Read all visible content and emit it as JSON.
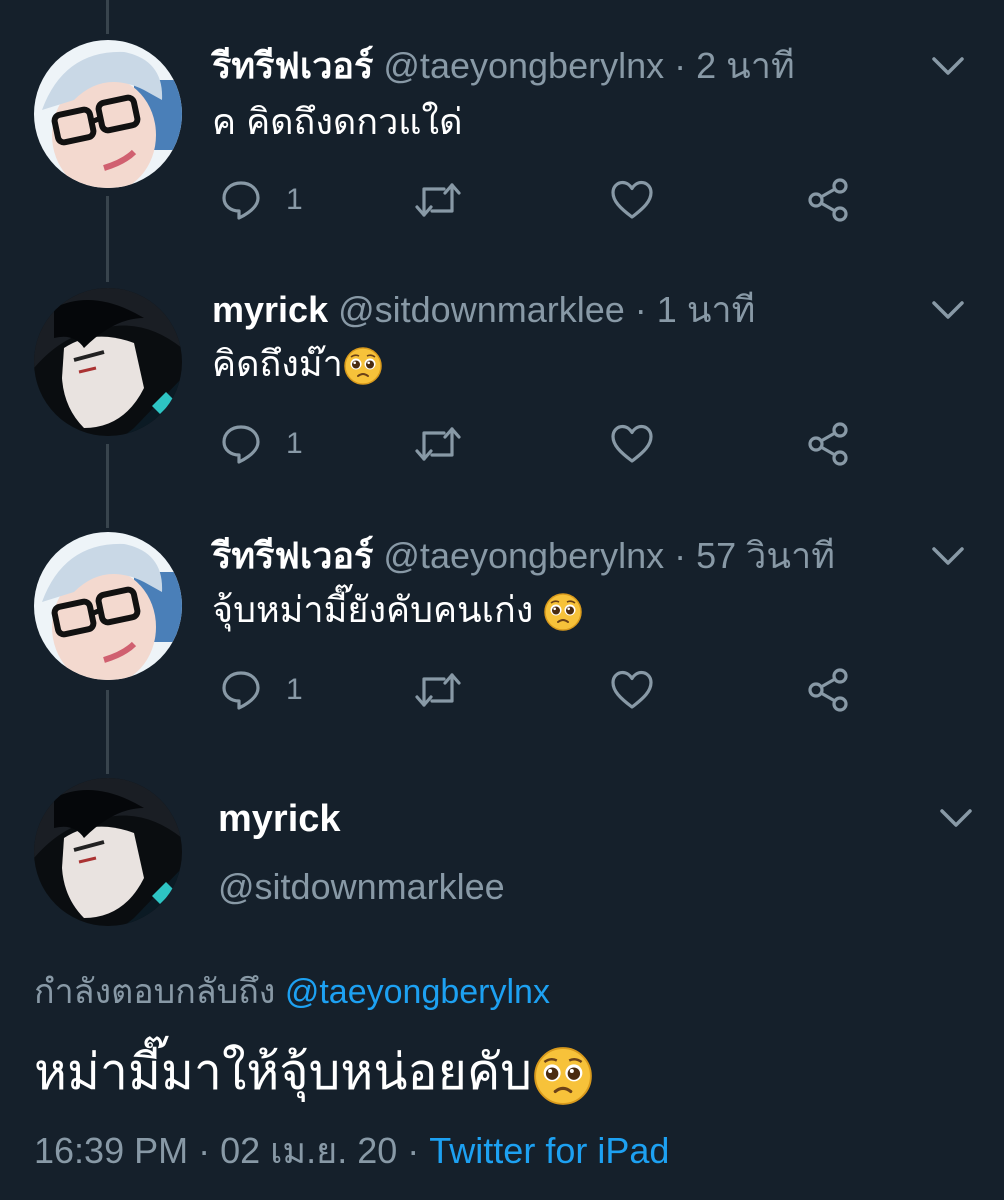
{
  "colors": {
    "background": "#15202b",
    "secondary_text": "#8899a6",
    "link": "#1da1f2",
    "thread_line": "#38444d"
  },
  "tweets": [
    {
      "name": "รีทรีฟเวอร์",
      "handle": "@taeyongberylnx",
      "separator": "·",
      "time": "2 นาที",
      "text": "ค คิดถึงดกวแใด่",
      "emoji": "",
      "reply_count": "1",
      "avatar_icon": "avatar-glasses"
    },
    {
      "name": "myrick",
      "handle": "@sitdownmarklee",
      "separator": "·",
      "time": "1 นาที",
      "text": "คิดถึงม๊า",
      "emoji": "pleading-face",
      "reply_count": "1",
      "avatar_icon": "avatar-dark"
    },
    {
      "name": "รีทรีฟเวอร์",
      "handle": "@taeyongberylnx",
      "separator": "·",
      "time": "57 วินาที",
      "text": "จุ้บหม่ามี๊ยังคับคนเก่ง ",
      "emoji": "pleading-face",
      "reply_count": "1",
      "avatar_icon": "avatar-glasses"
    }
  ],
  "main_tweet": {
    "name": "myrick",
    "handle": "@sitdownmarklee",
    "reply_prefix": "กำลังตอบกลับถึง ",
    "reply_to": "@taeyongberylnx",
    "text": "หม่ามี๊มาให้จุ้บหน่อยคับ",
    "emoji": "pleading-face",
    "timestamp": "16:39 PM · 02 เม.ย. 20 · ",
    "source": "Twitter for iPad"
  }
}
